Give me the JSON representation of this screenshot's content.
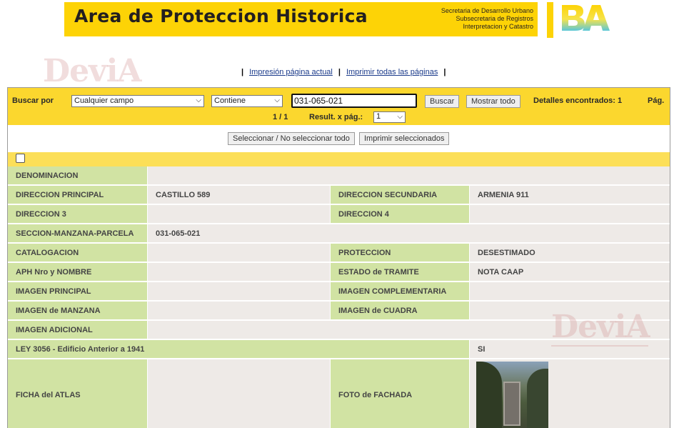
{
  "header": {
    "title": "Area de Proteccion Historica",
    "subtitle_lines": [
      "Secretaria de Desarrollo Urbano",
      "Subsecretaria de Registros",
      "Interpretacion y Catastro"
    ],
    "logo_text": "BA"
  },
  "watermark": "DeviA",
  "print_links": {
    "print_current": "Impresión página actual",
    "print_all": "Imprimir todas las páginas"
  },
  "search": {
    "label": "Buscar por",
    "field_value": "Cualquier campo",
    "operator_value": "Contiene",
    "query": "031-065-021",
    "search_button": "Buscar",
    "show_all_button": "Mostrar todo",
    "found_label": "Detalles encontrados: 1",
    "page_label": "Pág.",
    "page_indicator": "1 / 1",
    "per_page_label": "Result. x pág.:",
    "per_page_value": "1"
  },
  "actions": {
    "toggle_select": "Seleccionar / No seleccionar todo",
    "print_selected": "Imprimir seleccionados"
  },
  "details": {
    "denominacion_label": "DENOMINACION",
    "denominacion_value": "",
    "dir_principal_label": "DIRECCION PRINCIPAL",
    "dir_principal_value": "CASTILLO 589",
    "dir_secundaria_label": "DIRECCION SECUNDARIA",
    "dir_secundaria_value": "ARMENIA 911",
    "dir3_label": "DIRECCION 3",
    "dir3_value": "",
    "dir4_label": "DIRECCION 4",
    "dir4_value": "",
    "smp_label": "SECCION-MANZANA-PARCELA",
    "smp_value": "031-065-021",
    "catalogacion_label": "CATALOGACION",
    "catalogacion_value": "",
    "proteccion_label": "PROTECCION",
    "proteccion_value": "DESESTIMADO",
    "aph_label": "APH Nro y NOMBRE",
    "aph_value": "",
    "estado_label": "ESTADO de TRAMITE",
    "estado_value": "NOTA CAAP",
    "img_principal_label": "IMAGEN PRINCIPAL",
    "img_principal_value": "",
    "img_complementaria_label": "IMAGEN COMPLEMENTARIA",
    "img_complementaria_value": "",
    "img_manzana_label": "IMAGEN de MANZANA",
    "img_manzana_value": "",
    "img_cuadra_label": "IMAGEN de CUADRA",
    "img_cuadra_value": "",
    "img_adicional_label": "IMAGEN ADICIONAL",
    "img_adicional_value": "",
    "ley_label": "LEY 3056 - Edificio Anterior a 1941",
    "ley_value": "SI",
    "ficha_label": "FICHA del ATLAS",
    "ficha_value": "",
    "foto_label": "FOTO de FACHADA"
  },
  "colors": {
    "banner_yellow": "#fdd306",
    "search_bar_yellow": "#fbd72e",
    "label_green": "#d1e3a3",
    "value_gray": "#eeeae7",
    "link_blue": "#1a3a8a"
  }
}
